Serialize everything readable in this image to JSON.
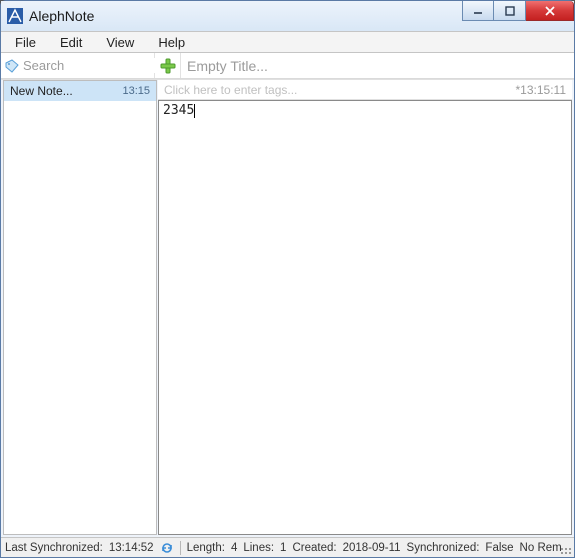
{
  "window": {
    "title": "AlephNote"
  },
  "menu": {
    "items": [
      "File",
      "Edit",
      "View",
      "Help"
    ]
  },
  "toolbar": {
    "search_placeholder": "Search",
    "title_placeholder": "Empty Title..."
  },
  "icons": {
    "app": "app-icon",
    "tag": "tag-icon",
    "add": "add-icon",
    "sync": "sync-icon"
  },
  "notes": {
    "items": [
      {
        "label": "New Note...",
        "time": "13:15",
        "selected": true
      }
    ]
  },
  "tags": {
    "placeholder": "Click here to enter tags...",
    "modified": "*13:15:11"
  },
  "editor": {
    "content": "2345"
  },
  "status": {
    "last_sync_label": "Last Synchronized:",
    "last_sync_value": "13:14:52",
    "length_label": "Length:",
    "length_value": "4",
    "lines_label": "Lines:",
    "lines_value": "1",
    "created_label": "Created:",
    "created_value": "2018-09-11",
    "synced_label": "Synchronized:",
    "synced_value": "False",
    "remote": "No Rem"
  }
}
